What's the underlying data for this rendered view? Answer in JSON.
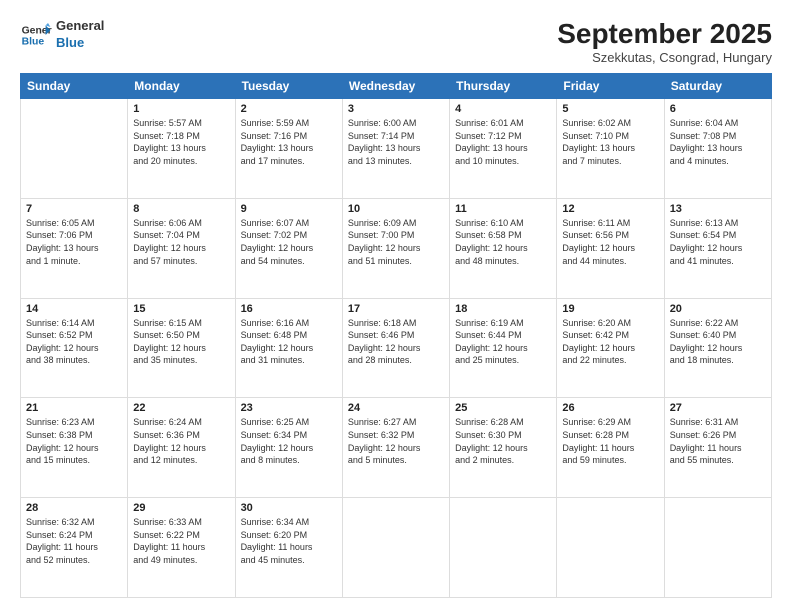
{
  "header": {
    "logo_line1": "General",
    "logo_line2": "Blue",
    "month_title": "September 2025",
    "subtitle": "Szekkutas, Csongrad, Hungary"
  },
  "days_of_week": [
    "Sunday",
    "Monday",
    "Tuesday",
    "Wednesday",
    "Thursday",
    "Friday",
    "Saturday"
  ],
  "weeks": [
    [
      {
        "day": "",
        "info": ""
      },
      {
        "day": "1",
        "info": "Sunrise: 5:57 AM\nSunset: 7:18 PM\nDaylight: 13 hours\nand 20 minutes."
      },
      {
        "day": "2",
        "info": "Sunrise: 5:59 AM\nSunset: 7:16 PM\nDaylight: 13 hours\nand 17 minutes."
      },
      {
        "day": "3",
        "info": "Sunrise: 6:00 AM\nSunset: 7:14 PM\nDaylight: 13 hours\nand 13 minutes."
      },
      {
        "day": "4",
        "info": "Sunrise: 6:01 AM\nSunset: 7:12 PM\nDaylight: 13 hours\nand 10 minutes."
      },
      {
        "day": "5",
        "info": "Sunrise: 6:02 AM\nSunset: 7:10 PM\nDaylight: 13 hours\nand 7 minutes."
      },
      {
        "day": "6",
        "info": "Sunrise: 6:04 AM\nSunset: 7:08 PM\nDaylight: 13 hours\nand 4 minutes."
      }
    ],
    [
      {
        "day": "7",
        "info": "Sunrise: 6:05 AM\nSunset: 7:06 PM\nDaylight: 13 hours\nand 1 minute."
      },
      {
        "day": "8",
        "info": "Sunrise: 6:06 AM\nSunset: 7:04 PM\nDaylight: 12 hours\nand 57 minutes."
      },
      {
        "day": "9",
        "info": "Sunrise: 6:07 AM\nSunset: 7:02 PM\nDaylight: 12 hours\nand 54 minutes."
      },
      {
        "day": "10",
        "info": "Sunrise: 6:09 AM\nSunset: 7:00 PM\nDaylight: 12 hours\nand 51 minutes."
      },
      {
        "day": "11",
        "info": "Sunrise: 6:10 AM\nSunset: 6:58 PM\nDaylight: 12 hours\nand 48 minutes."
      },
      {
        "day": "12",
        "info": "Sunrise: 6:11 AM\nSunset: 6:56 PM\nDaylight: 12 hours\nand 44 minutes."
      },
      {
        "day": "13",
        "info": "Sunrise: 6:13 AM\nSunset: 6:54 PM\nDaylight: 12 hours\nand 41 minutes."
      }
    ],
    [
      {
        "day": "14",
        "info": "Sunrise: 6:14 AM\nSunset: 6:52 PM\nDaylight: 12 hours\nand 38 minutes."
      },
      {
        "day": "15",
        "info": "Sunrise: 6:15 AM\nSunset: 6:50 PM\nDaylight: 12 hours\nand 35 minutes."
      },
      {
        "day": "16",
        "info": "Sunrise: 6:16 AM\nSunset: 6:48 PM\nDaylight: 12 hours\nand 31 minutes."
      },
      {
        "day": "17",
        "info": "Sunrise: 6:18 AM\nSunset: 6:46 PM\nDaylight: 12 hours\nand 28 minutes."
      },
      {
        "day": "18",
        "info": "Sunrise: 6:19 AM\nSunset: 6:44 PM\nDaylight: 12 hours\nand 25 minutes."
      },
      {
        "day": "19",
        "info": "Sunrise: 6:20 AM\nSunset: 6:42 PM\nDaylight: 12 hours\nand 22 minutes."
      },
      {
        "day": "20",
        "info": "Sunrise: 6:22 AM\nSunset: 6:40 PM\nDaylight: 12 hours\nand 18 minutes."
      }
    ],
    [
      {
        "day": "21",
        "info": "Sunrise: 6:23 AM\nSunset: 6:38 PM\nDaylight: 12 hours\nand 15 minutes."
      },
      {
        "day": "22",
        "info": "Sunrise: 6:24 AM\nSunset: 6:36 PM\nDaylight: 12 hours\nand 12 minutes."
      },
      {
        "day": "23",
        "info": "Sunrise: 6:25 AM\nSunset: 6:34 PM\nDaylight: 12 hours\nand 8 minutes."
      },
      {
        "day": "24",
        "info": "Sunrise: 6:27 AM\nSunset: 6:32 PM\nDaylight: 12 hours\nand 5 minutes."
      },
      {
        "day": "25",
        "info": "Sunrise: 6:28 AM\nSunset: 6:30 PM\nDaylight: 12 hours\nand 2 minutes."
      },
      {
        "day": "26",
        "info": "Sunrise: 6:29 AM\nSunset: 6:28 PM\nDaylight: 11 hours\nand 59 minutes."
      },
      {
        "day": "27",
        "info": "Sunrise: 6:31 AM\nSunset: 6:26 PM\nDaylight: 11 hours\nand 55 minutes."
      }
    ],
    [
      {
        "day": "28",
        "info": "Sunrise: 6:32 AM\nSunset: 6:24 PM\nDaylight: 11 hours\nand 52 minutes."
      },
      {
        "day": "29",
        "info": "Sunrise: 6:33 AM\nSunset: 6:22 PM\nDaylight: 11 hours\nand 49 minutes."
      },
      {
        "day": "30",
        "info": "Sunrise: 6:34 AM\nSunset: 6:20 PM\nDaylight: 11 hours\nand 45 minutes."
      },
      {
        "day": "",
        "info": ""
      },
      {
        "day": "",
        "info": ""
      },
      {
        "day": "",
        "info": ""
      },
      {
        "day": "",
        "info": ""
      }
    ]
  ]
}
